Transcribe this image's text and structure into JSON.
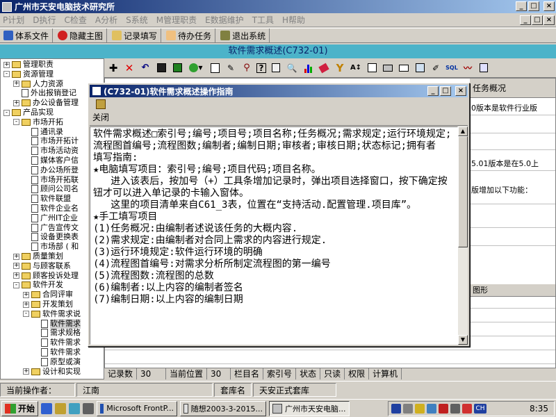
{
  "app": {
    "title": "广州市天安电脑技术研究所",
    "minimize": "_",
    "maximize": "□",
    "close": "×"
  },
  "menu": {
    "items": [
      "P计划",
      "D执行",
      "C检查",
      "A分析",
      "S系统",
      "M管理职责",
      "E数据维护",
      "T工具",
      "H帮助"
    ]
  },
  "toolbar": {
    "system_file": "体系文件",
    "hide_main": "隐藏主图",
    "record_fill": "记录填写",
    "todo": "待办任务",
    "exit": "退出系统"
  },
  "inner_window": {
    "title": "软件需求概述(C732-01)"
  },
  "tree": {
    "items": [
      {
        "label": "管理职责",
        "exp": "+",
        "icon": "folder",
        "indent": 0
      },
      {
        "label": "资源管理",
        "exp": "-",
        "icon": "folder",
        "indent": 0
      },
      {
        "label": "人力资源",
        "exp": "+",
        "icon": "folder",
        "indent": 1
      },
      {
        "label": "外出报销登记",
        "exp": "",
        "icon": "doc",
        "indent": 1
      },
      {
        "label": "办公设备管理",
        "exp": "+",
        "icon": "folder",
        "indent": 1
      },
      {
        "label": "产品实现",
        "exp": "-",
        "icon": "folder",
        "indent": 0
      },
      {
        "label": "市场开拓",
        "exp": "-",
        "icon": "folder",
        "indent": 1
      },
      {
        "label": "通讯录",
        "exp": "",
        "icon": "doc",
        "indent": 2
      },
      {
        "label": "市场开拓计",
        "exp": "",
        "icon": "doc",
        "indent": 2
      },
      {
        "label": "市场活动资",
        "exp": "",
        "icon": "doc",
        "indent": 2
      },
      {
        "label": "媒体客户信",
        "exp": "",
        "icon": "doc",
        "indent": 2
      },
      {
        "label": "办公场所登",
        "exp": "",
        "icon": "doc",
        "indent": 2
      },
      {
        "label": "市场开拓联",
        "exp": "",
        "icon": "doc",
        "indent": 2
      },
      {
        "label": "顾问公司名",
        "exp": "",
        "icon": "doc",
        "indent": 2
      },
      {
        "label": "软件联盟",
        "exp": "",
        "icon": "doc",
        "indent": 2
      },
      {
        "label": "软件企业名",
        "exp": "",
        "icon": "doc",
        "indent": 2
      },
      {
        "label": "广州IT企业",
        "exp": "",
        "icon": "doc",
        "indent": 2
      },
      {
        "label": "广告宣传文",
        "exp": "",
        "icon": "doc",
        "indent": 2
      },
      {
        "label": "设备更换表",
        "exp": "",
        "icon": "doc",
        "indent": 2
      },
      {
        "label": "市场部 ( 和",
        "exp": "",
        "icon": "doc",
        "indent": 2
      },
      {
        "label": "质量策划",
        "exp": "+",
        "icon": "folder",
        "indent": 1
      },
      {
        "label": "与顾客联系",
        "exp": "+",
        "icon": "folder",
        "indent": 1
      },
      {
        "label": "顾客投诉处理",
        "exp": "+",
        "icon": "folder",
        "indent": 1
      },
      {
        "label": "软件开发",
        "exp": "-",
        "icon": "folder",
        "indent": 1
      },
      {
        "label": "合同评审",
        "exp": "+",
        "icon": "folder",
        "indent": 2
      },
      {
        "label": "开发策划",
        "exp": "+",
        "icon": "folder",
        "indent": 2
      },
      {
        "label": "软件需求说",
        "exp": "-",
        "icon": "folder",
        "indent": 2
      },
      {
        "label": "软件需求",
        "exp": "",
        "icon": "doc",
        "indent": 3,
        "selected": true
      },
      {
        "label": "需求规格",
        "exp": "",
        "icon": "doc",
        "indent": 3
      },
      {
        "label": "软件需求",
        "exp": "",
        "icon": "doc",
        "indent": 3
      },
      {
        "label": "软件需求",
        "exp": "",
        "icon": "doc",
        "indent": 3
      },
      {
        "label": "原型或演",
        "exp": "",
        "icon": "doc",
        "indent": 3
      },
      {
        "label": "设计和实现",
        "exp": "+",
        "icon": "folder",
        "indent": 2
      }
    ]
  },
  "grid": {
    "col_header": "任务概况",
    "cells": [
      "0版本是软件行业版",
      "5.01版本是在5.0上",
      "版增加以下功能："
    ],
    "sub_header": "图形"
  },
  "record_bar": {
    "count_label": "记录数",
    "count_value": "30",
    "pos_label": "当前位置",
    "pos_value": "30",
    "fields": [
      "栏目名",
      "索引号",
      "状态",
      "只读",
      "权限",
      "计算机"
    ]
  },
  "operator": {
    "label": "当前操作者：",
    "name": "江南",
    "lib_label": "套库名",
    "lib_value": "天安正式套库"
  },
  "taskbar": {
    "start": "开始",
    "tasks": [
      "Microsoft FrontP...",
      "随想2003-3-2015...",
      "广州市天安电脑..."
    ],
    "tray_lang": "CH",
    "clock": "8:35"
  },
  "dialog": {
    "title": "(C732-01)软件需求概述操作指南",
    "close_label": "关闭",
    "lines": [
      "软件需求概述□索引号;编号;项目号;项目名称;任务概况;需求规定;运行环境规定;流程图首编号;流程图数;编制者;编制日期;审核者;审核日期;状态标记;拥有者",
      "",
      "填写指南:",
      "★电脑填写项目：索引号;编号;项目代码;项目名称。",
      "   进入该表后，按加号（+）工具条增加记录时，弹出项目选择窗口，按下确定按钮才可以进入单记录的卡输入窗体。",
      "   这里的项目清单来自C61_3表，位置在“支持活动.配置管理.项目库”。",
      "",
      "★手工填写项目",
      "(1)任务概况:由编制者述说该任务的大概内容.",
      "(2)需求规定:由编制者对合同上需求的内容进行规定.",
      "(3)运行环境规定:软件运行环境的明确",
      "(4)流程图首编号:对需求分析所制定流程图的第一编号",
      "(5)流程图数:流程图的总数",
      "(6)编制者:以上内容的编制者签名",
      "(7)编制日期:以上内容的编制日期"
    ]
  },
  "colors": {
    "title_gradient_start": "#0a246a",
    "title_gradient_end": "#a6caf0",
    "inner_title_bg": "#4cb3c9",
    "face": "#d4d0c8"
  }
}
